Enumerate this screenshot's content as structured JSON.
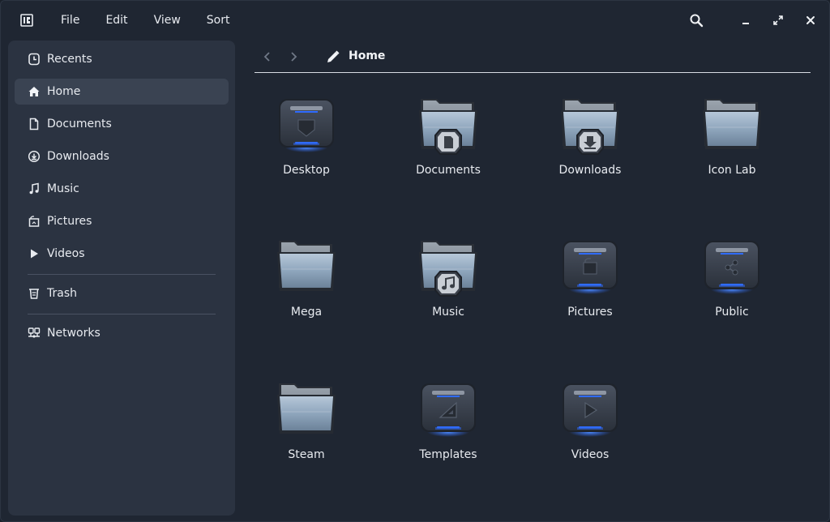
{
  "menu": [
    "File",
    "Edit",
    "View",
    "Sort"
  ],
  "sidebar": {
    "items": [
      {
        "label": "Recents",
        "icon": "clock-icon"
      },
      {
        "label": "Home",
        "icon": "home-icon",
        "active": true
      },
      {
        "label": "Documents",
        "icon": "document-icon"
      },
      {
        "label": "Downloads",
        "icon": "download-icon"
      },
      {
        "label": "Music",
        "icon": "music-note-icon"
      },
      {
        "label": "Pictures",
        "icon": "picture-icon"
      },
      {
        "label": "Videos",
        "icon": "play-icon"
      }
    ],
    "trash": {
      "label": "Trash",
      "icon": "trash-icon"
    },
    "networks": {
      "label": "Networks",
      "icon": "network-icon"
    }
  },
  "path": {
    "current": "Home"
  },
  "files": [
    {
      "name": "Desktop",
      "kind": "desktop-folder-icon"
    },
    {
      "name": "Documents",
      "kind": "documents-folder-icon"
    },
    {
      "name": "Downloads",
      "kind": "downloads-folder-icon"
    },
    {
      "name": "Icon Lab",
      "kind": "folder-icon"
    },
    {
      "name": "Mega",
      "kind": "folder-icon"
    },
    {
      "name": "Music",
      "kind": "music-folder-icon"
    },
    {
      "name": "Pictures",
      "kind": "pictures-folder-icon"
    },
    {
      "name": "Public",
      "kind": "public-folder-icon"
    },
    {
      "name": "Steam",
      "kind": "folder-icon"
    },
    {
      "name": "Templates",
      "kind": "templates-folder-icon"
    },
    {
      "name": "Videos",
      "kind": "videos-folder-icon"
    }
  ],
  "colors": {
    "accent": "#2f6bff",
    "sidebar": "#2b3341",
    "window": "#1f2632"
  }
}
